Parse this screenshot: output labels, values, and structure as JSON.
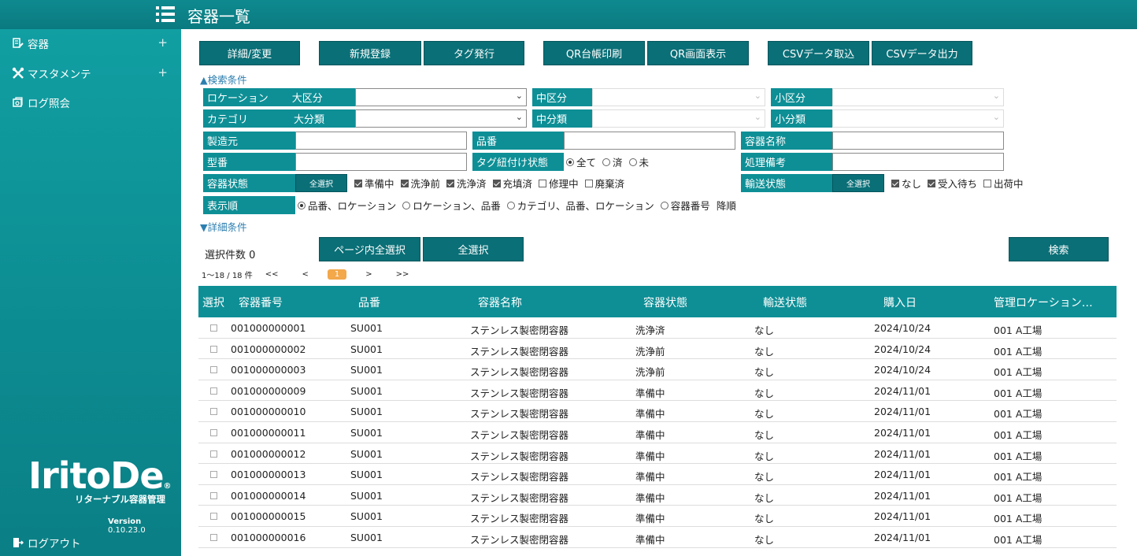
{
  "header": {
    "title": "容器一覧"
  },
  "sidebar": {
    "items": [
      {
        "label": "容器",
        "expand": "+"
      },
      {
        "label": "マスタメンテ",
        "expand": "+"
      },
      {
        "label": "ログ照会"
      }
    ],
    "logo_main": "IritoDe",
    "logo_mark": "®",
    "logo_sub": "リターナブル容器管理",
    "version_label": "Version",
    "version_number": "0.10.23.0",
    "logout": "ログアウト"
  },
  "toolbar": {
    "detail": "詳細/変更",
    "new": "新規登録",
    "tag": "タグ発行",
    "qr_print": "QR台帳印刷",
    "qr_show": "QR画面表示",
    "csv_import": "CSVデータ取込",
    "csv_export": "CSVデータ出力"
  },
  "search": {
    "toggle": "▲検索条件",
    "detail_toggle": "▼詳細条件",
    "location": "ロケーション",
    "large_area": "大区分",
    "middle_area": "中区分",
    "small_area": "小区分",
    "category": "カテゴリ",
    "large_cat": "大分類",
    "middle_cat": "中分類",
    "small_cat": "小分類",
    "maker": "製造元",
    "part_no": "品番",
    "container_name": "容器名称",
    "model": "型番",
    "tag_state": "タグ紐付け状態",
    "tag_opts": [
      "全て",
      "済",
      "未"
    ],
    "remarks": "処理備考",
    "container_state": "容器状態",
    "select_all": "全選択",
    "state_opts": [
      {
        "label": "準備中",
        "checked": true
      },
      {
        "label": "洗浄前",
        "checked": true
      },
      {
        "label": "洗浄済",
        "checked": true
      },
      {
        "label": "充填済",
        "checked": true
      },
      {
        "label": "修理中",
        "checked": false
      },
      {
        "label": "廃棄済",
        "checked": false
      }
    ],
    "transport_state": "輸送状態",
    "transport_opts": [
      {
        "label": "なし",
        "checked": true
      },
      {
        "label": "受入待ち",
        "checked": true
      },
      {
        "label": "出荷中",
        "checked": false
      }
    ],
    "order": "表示順",
    "order_opts": [
      "品番、ロケーション",
      "ロケーション、品番",
      "カテゴリ、品番、ロケーション",
      "容器番号"
    ],
    "desc": "降順"
  },
  "selection": {
    "count": "選択件数 0",
    "page_select": "ページ内全選択",
    "select_all": "全選択",
    "search": "検索"
  },
  "pager": {
    "range": "1～18 / 18 件",
    "first": "<<",
    "prev": "<",
    "current": "1",
    "next": ">",
    "last": ">>"
  },
  "table": {
    "headers": [
      "選択",
      "容器番号",
      "品番",
      "容器名称",
      "容器状態",
      "輸送状態",
      "購入日",
      "管理ロケーション…"
    ],
    "rows": [
      [
        "001000000001",
        "SU001",
        "ステンレス製密閉容器",
        "洗浄済",
        "なし",
        "2024/10/24",
        "001 A工場"
      ],
      [
        "001000000002",
        "SU001",
        "ステンレス製密閉容器",
        "洗浄前",
        "なし",
        "2024/10/24",
        "001 A工場"
      ],
      [
        "001000000003",
        "SU001",
        "ステンレス製密閉容器",
        "洗浄前",
        "なし",
        "2024/10/24",
        "001 A工場"
      ],
      [
        "001000000009",
        "SU001",
        "ステンレス製密閉容器",
        "準備中",
        "なし",
        "2024/11/01",
        "001 A工場"
      ],
      [
        "001000000010",
        "SU001",
        "ステンレス製密閉容器",
        "準備中",
        "なし",
        "2024/11/01",
        "001 A工場"
      ],
      [
        "001000000011",
        "SU001",
        "ステンレス製密閉容器",
        "準備中",
        "なし",
        "2024/11/01",
        "001 A工場"
      ],
      [
        "001000000012",
        "SU001",
        "ステンレス製密閉容器",
        "準備中",
        "なし",
        "2024/11/01",
        "001 A工場"
      ],
      [
        "001000000013",
        "SU001",
        "ステンレス製密閉容器",
        "準備中",
        "なし",
        "2024/11/01",
        "001 A工場"
      ],
      [
        "001000000014",
        "SU001",
        "ステンレス製密閉容器",
        "準備中",
        "なし",
        "2024/11/01",
        "001 A工場"
      ],
      [
        "001000000015",
        "SU001",
        "ステンレス製密閉容器",
        "準備中",
        "なし",
        "2024/11/01",
        "001 A工場"
      ],
      [
        "001000000016",
        "SU001",
        "ステンレス製密閉容器",
        "準備中",
        "なし",
        "2024/11/01",
        "001 A工場"
      ]
    ]
  }
}
